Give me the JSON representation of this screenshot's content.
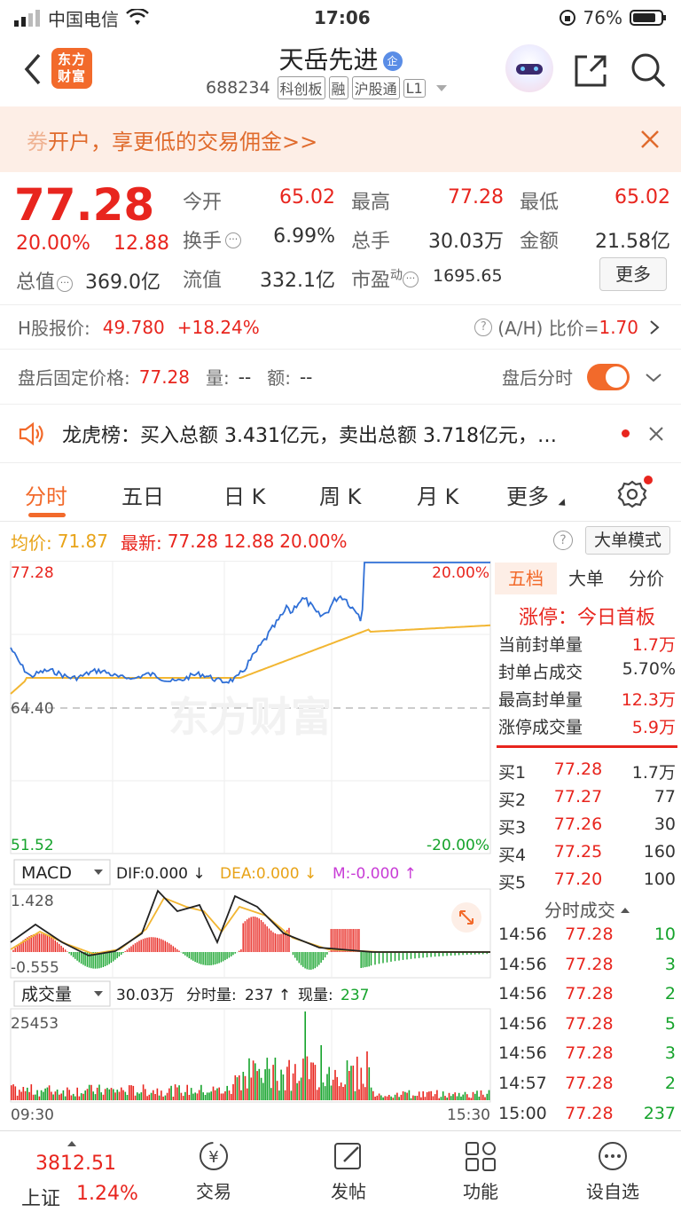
{
  "status_bar": {
    "carrier": "中国电信",
    "time": "17:06",
    "battery": "76%"
  },
  "header": {
    "brand_logo_text": "东方财富",
    "stock_name": "天岳先进",
    "name_badge": "企",
    "code": "688234",
    "tags": [
      "科创板",
      "融",
      "沪股通",
      "L1"
    ]
  },
  "banner": {
    "text_prefix": "券",
    "text": "开户，享更低的交易佣金>>"
  },
  "quote": {
    "price": "77.28",
    "change_pct": "20.00%",
    "change": "12.88",
    "open_label": "今开",
    "open": "65.02",
    "high_label": "最高",
    "high": "77.28",
    "low_label": "最低",
    "low": "65.02",
    "turnover_label": "换手",
    "turnover": "6.99%",
    "volume_label": "总手",
    "volume": "30.03万",
    "amount_label": "金额",
    "amount": "21.58亿",
    "mktcap_label": "总值",
    "mktcap": "369.0亿",
    "float_label": "流值",
    "float_cap": "332.1亿",
    "pe_label": "市盈",
    "pe_sup": "动",
    "pe": "1695.65",
    "more_button": "更多"
  },
  "h_share": {
    "label": "H股报价:",
    "price": "49.780",
    "change": "+18.24%",
    "ah_label": "(A/H) 比价=",
    "ah_value": "1.70"
  },
  "after_hours": {
    "label": "盘后固定价格:",
    "price": "77.28",
    "vol_label": "量:",
    "vol": "--",
    "amt_label": "额:",
    "amt": "--",
    "toggle_label": "盘后分时"
  },
  "dragon_tiger": {
    "text": "龙虎榜：买入总额 3.431亿元，卖出总额 3.718亿元，…"
  },
  "tabs": [
    "分时",
    "五日",
    "日 K",
    "周 K",
    "月 K",
    "更多"
  ],
  "chart_header": {
    "avg_label": "均价:",
    "avg": "71.87",
    "latest_label": "最新:",
    "latest": "77.28",
    "latest_change": "12.88",
    "latest_pct": "20.00%",
    "big_order_button": "大单模式"
  },
  "main_chart_labels": {
    "top_left": "77.28",
    "top_right": "20.00%",
    "mid": "64.40",
    "bottom_left": "51.52",
    "bottom_right": "-20.00%",
    "watermark": "东方财富"
  },
  "macd": {
    "selector": "MACD",
    "dif": "DIF:0.000 ↓",
    "dea": "DEA:0.000 ↓",
    "m": "M:-0.000 ↑",
    "max": "1.428",
    "min": "-0.555"
  },
  "volume": {
    "selector": "成交量",
    "total": "30.03万",
    "minute_label": "分时量:",
    "minute": "237 ↑",
    "now_label": "现量:",
    "now": "237",
    "max": "25453",
    "time_start": "09:30",
    "time_end": "15:30"
  },
  "right_tabs": [
    "五档",
    "大单",
    "分价"
  ],
  "limit_up": {
    "title": "涨停：今日首板",
    "rows": [
      {
        "label": "当前封单量",
        "value": "1.7万"
      },
      {
        "label": "封单占成交",
        "value": "5.70%"
      },
      {
        "label": "最高封单量",
        "value": "12.3万"
      },
      {
        "label": "涨停成交量",
        "value": "5.9万"
      }
    ]
  },
  "order_book": [
    {
      "label": "买1",
      "price": "77.28",
      "qty": "1.7万"
    },
    {
      "label": "买2",
      "price": "77.27",
      "qty": "77"
    },
    {
      "label": "买3",
      "price": "77.26",
      "qty": "30"
    },
    {
      "label": "买4",
      "price": "77.25",
      "qty": "160"
    },
    {
      "label": "买5",
      "price": "77.20",
      "qty": "100"
    }
  ],
  "trades_title": "分时成交",
  "trades": [
    {
      "time": "14:56",
      "price": "77.28",
      "qty": "10"
    },
    {
      "time": "14:56",
      "price": "77.28",
      "qty": "3"
    },
    {
      "time": "14:56",
      "price": "77.28",
      "qty": "2"
    },
    {
      "time": "14:56",
      "price": "77.28",
      "qty": "5"
    },
    {
      "time": "14:56",
      "price": "77.28",
      "qty": "3"
    },
    {
      "time": "14:57",
      "price": "77.28",
      "qty": "2"
    },
    {
      "time": "15:00",
      "price": "77.28",
      "qty": "237"
    }
  ],
  "bottom_nav": {
    "index_value": "3812.51",
    "index_name": "上证",
    "index_change": "1.24%",
    "items": [
      "交易",
      "发帖",
      "功能",
      "设自选"
    ]
  },
  "colors": {
    "up": "#e8251e",
    "down": "#15a32b",
    "accent": "#f26a2b",
    "price_line": "#2f6fd6",
    "avg_line": "#f2b632"
  }
}
